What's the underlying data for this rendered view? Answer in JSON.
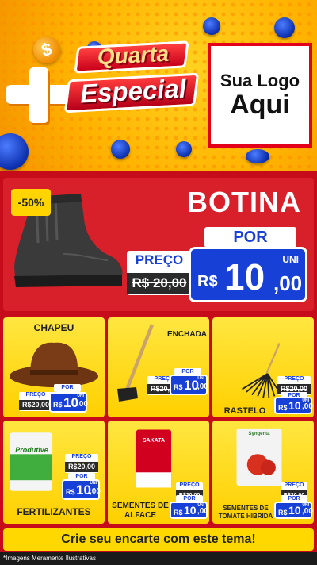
{
  "header": {
    "title_line1": "Quarta",
    "title_line2": "Especial",
    "coin_symbol": "$",
    "logo_line1": "Sua Logo",
    "logo_line2": "Aqui"
  },
  "hero": {
    "discount": "-50%",
    "name": "BOTINA",
    "por_label": "POR",
    "preco_label": "PREÇO",
    "old_price": "R$ 20,00",
    "currency": "R$",
    "price_int": "10",
    "price_cents": ",00",
    "unit": "UNI"
  },
  "products": [
    {
      "name": "CHAPEU",
      "preco_label": "PREÇO",
      "old_price": "R$20,00",
      "por_label": "POR",
      "currency": "R$",
      "price_int": "10",
      "price_cents": ",00",
      "unit": "UNI"
    },
    {
      "name": "ENCHADA",
      "preco_label": "PREÇO",
      "old_price": "R$20,00",
      "por_label": "POR",
      "currency": "R$",
      "price_int": "10",
      "price_cents": ",00",
      "unit": "UNI"
    },
    {
      "name": "RASTELO",
      "preco_label": "PREÇO",
      "old_price": "R$20,00",
      "por_label": "POR",
      "currency": "R$",
      "price_int": "10",
      "price_cents": ",00",
      "unit": "UNI"
    },
    {
      "name": "FERTILIZANTES",
      "preco_label": "PREÇO",
      "old_price": "R$20,00",
      "por_label": "POR",
      "currency": "R$",
      "price_int": "10",
      "price_cents": ",00",
      "unit": "UNI",
      "package_label": "Produtive"
    },
    {
      "name_line1": "SEMENTES DE",
      "name_line2": "ALFACE",
      "preco_label": "PREÇO",
      "old_price": "R$20,00",
      "por_label": "POR",
      "currency": "R$",
      "price_int": "10",
      "price_cents": ",00",
      "unit": "UNI",
      "package_label": "SAKATA"
    },
    {
      "name_line1": "SEMENTES DE",
      "name_line2": "TOMATE HIBRIDA",
      "preco_label": "PREÇO",
      "old_price": "R$20,00",
      "por_label": "POR",
      "currency": "R$",
      "price_int": "10",
      "price_cents": ",00",
      "unit": "UNI",
      "package_label": "Syngenta"
    }
  ],
  "cta_text": "Crie seu encarte com este tema!",
  "footer_note": "*Imagens Meramente Ilustrativas",
  "colors": {
    "red": "#c60c1b",
    "yellow": "#ffd800",
    "blue": "#1740d6",
    "orange": "#f39200"
  }
}
